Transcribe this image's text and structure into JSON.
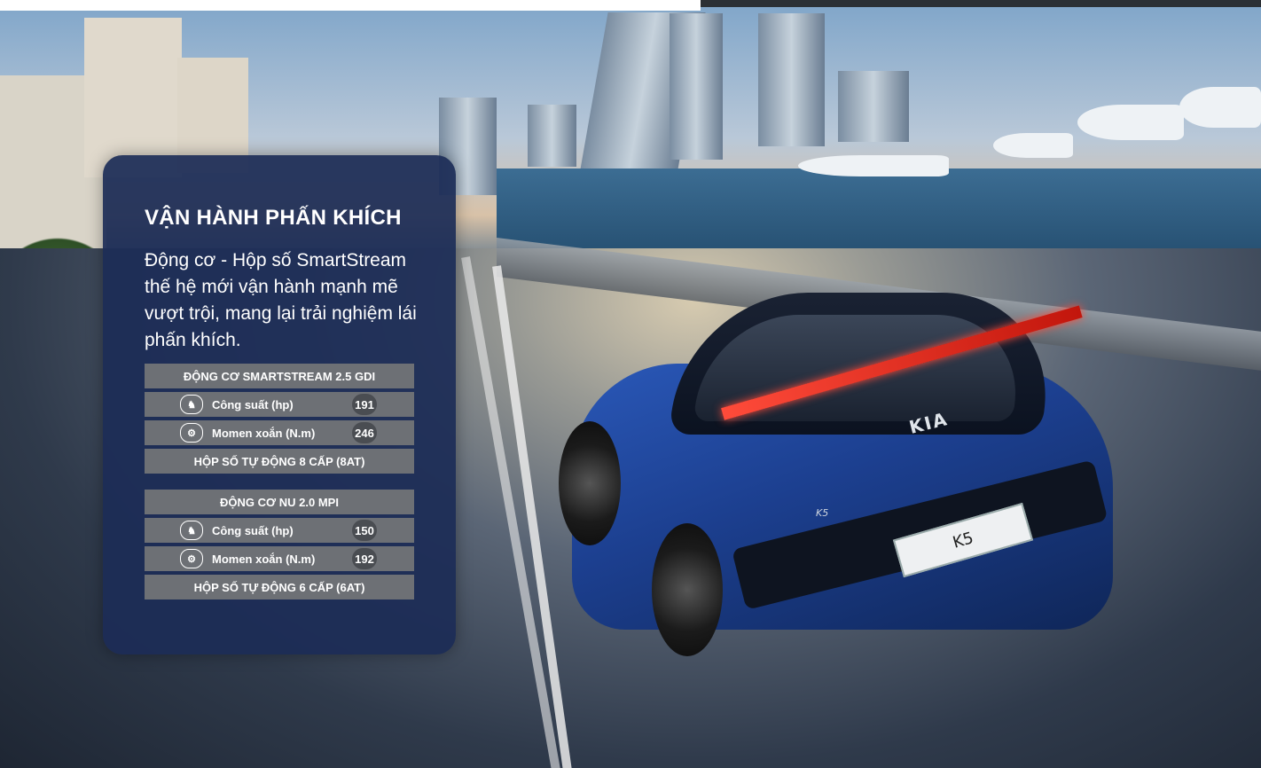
{
  "panel": {
    "title": "VẬN HÀNH PHẤN KHÍCH",
    "description": "Động cơ - Hộp số SmartStream thế hệ mới vận hành mạnh mẽ vượt trội, mang lại trải nghiệm lái phấn khích."
  },
  "engines": [
    {
      "name": "ĐỘNG CƠ SMARTSTREAM 2.5 GDI",
      "power_label": "Công suất (hp)",
      "power_value": "191",
      "torque_label": "Momen xoắn (N.m)",
      "torque_value": "246",
      "transmission": "HỘP SỐ TỰ ĐỘNG 8 CẤP (8AT)"
    },
    {
      "name": "ĐỘNG CƠ NU 2.0 MPI",
      "power_label": "Công suất (hp)",
      "power_value": "150",
      "torque_label": "Momen xoắn (N.m)",
      "torque_value": "192",
      "transmission": "HỘP SỐ TỰ ĐỘNG 6 CẤP (6AT)"
    }
  ],
  "car": {
    "plate": "K5",
    "logo": "KIA",
    "model": "K5"
  },
  "icons": {
    "power": "horse-icon",
    "torque": "gear-icon"
  }
}
